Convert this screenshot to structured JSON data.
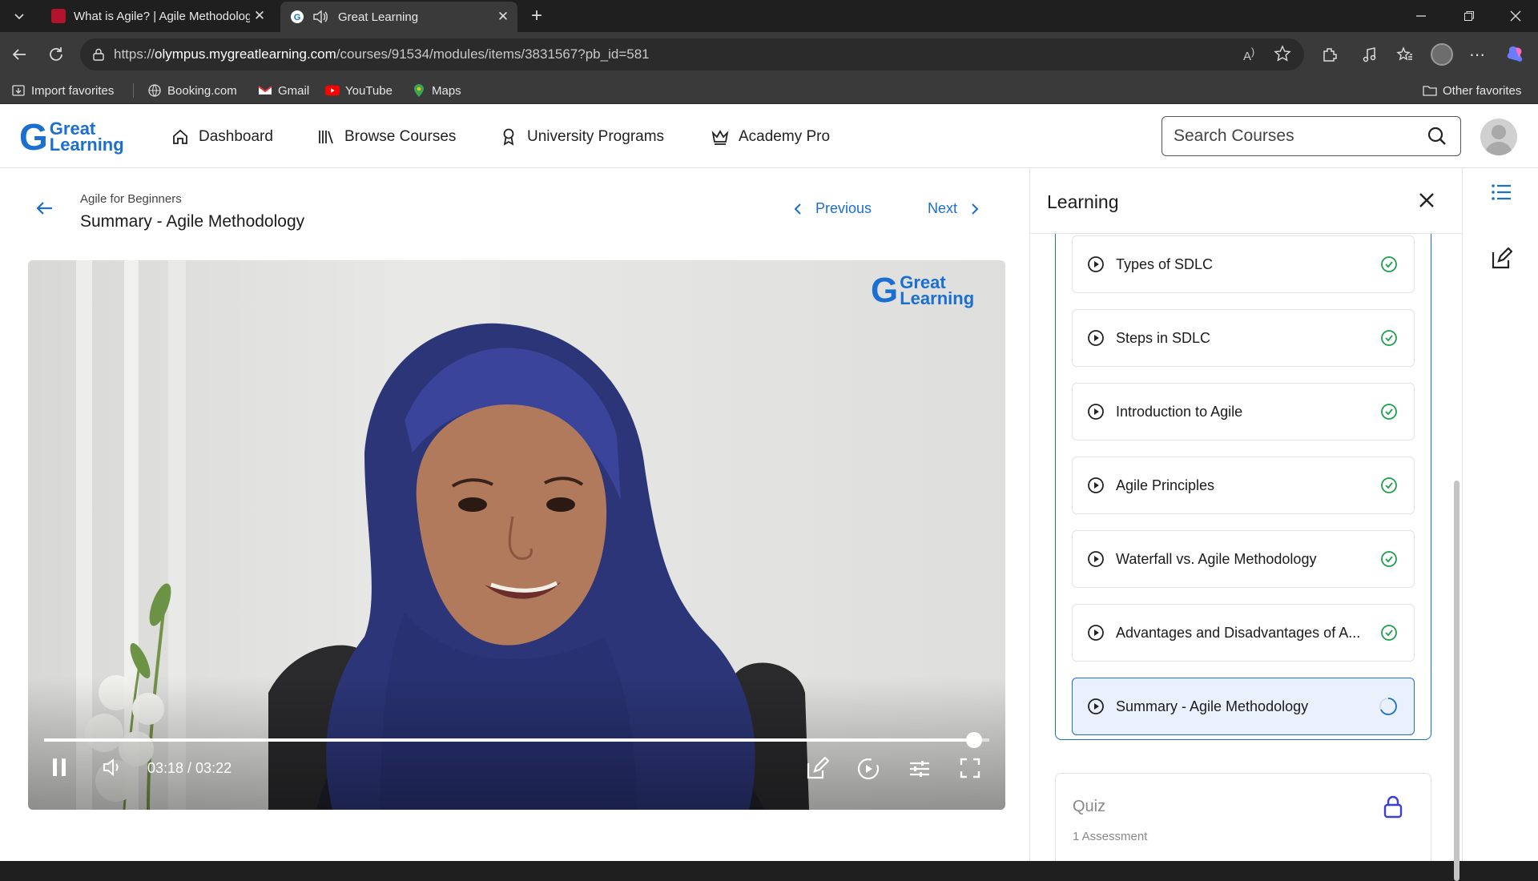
{
  "browser": {
    "tabs": [
      {
        "title": "What is Agile? | Agile Methodolog",
        "active": false
      },
      {
        "title": "Great Learning",
        "active": true
      }
    ],
    "url_prefix": "https://",
    "url_host": "olympus.mygreatlearning.com",
    "url_path": "/courses/91534/modules/items/3831567?pb_id=581",
    "favorites": [
      "Import favorites",
      "Booking.com",
      "Gmail",
      "YouTube",
      "Maps"
    ],
    "other_favorites": "Other favorites"
  },
  "site": {
    "logo_line1": "Great",
    "logo_line2": "Learning",
    "nav": [
      "Dashboard",
      "Browse Courses",
      "University Programs",
      "Academy Pro"
    ],
    "search_placeholder": "Search Courses"
  },
  "lesson": {
    "course": "Agile for Beginners",
    "title": "Summary - Agile Methodology",
    "previous": "Previous",
    "next": "Next"
  },
  "video": {
    "logo_line1": "Great",
    "logo_line2": "Learning",
    "time": "03:18 / 03:22",
    "progress": 0.984
  },
  "sidebar": {
    "title": "Learning",
    "items": [
      {
        "label": "Types of SDLC",
        "status": "done"
      },
      {
        "label": "Steps in SDLC",
        "status": "done"
      },
      {
        "label": "Introduction to Agile",
        "status": "done"
      },
      {
        "label": "Agile Principles",
        "status": "done"
      },
      {
        "label": "Waterfall vs. Agile Methodology",
        "status": "done"
      },
      {
        "label": "Advantages and Disadvantages of A...",
        "status": "done"
      },
      {
        "label": "Summary - Agile Methodology",
        "status": "in-progress"
      }
    ],
    "quiz_title": "Quiz",
    "quiz_sub": "1 Assessment"
  },
  "colors": {
    "accent": "#1a6fd1",
    "success": "#1e9e4e",
    "quiz_lock": "#3b3fd8"
  }
}
